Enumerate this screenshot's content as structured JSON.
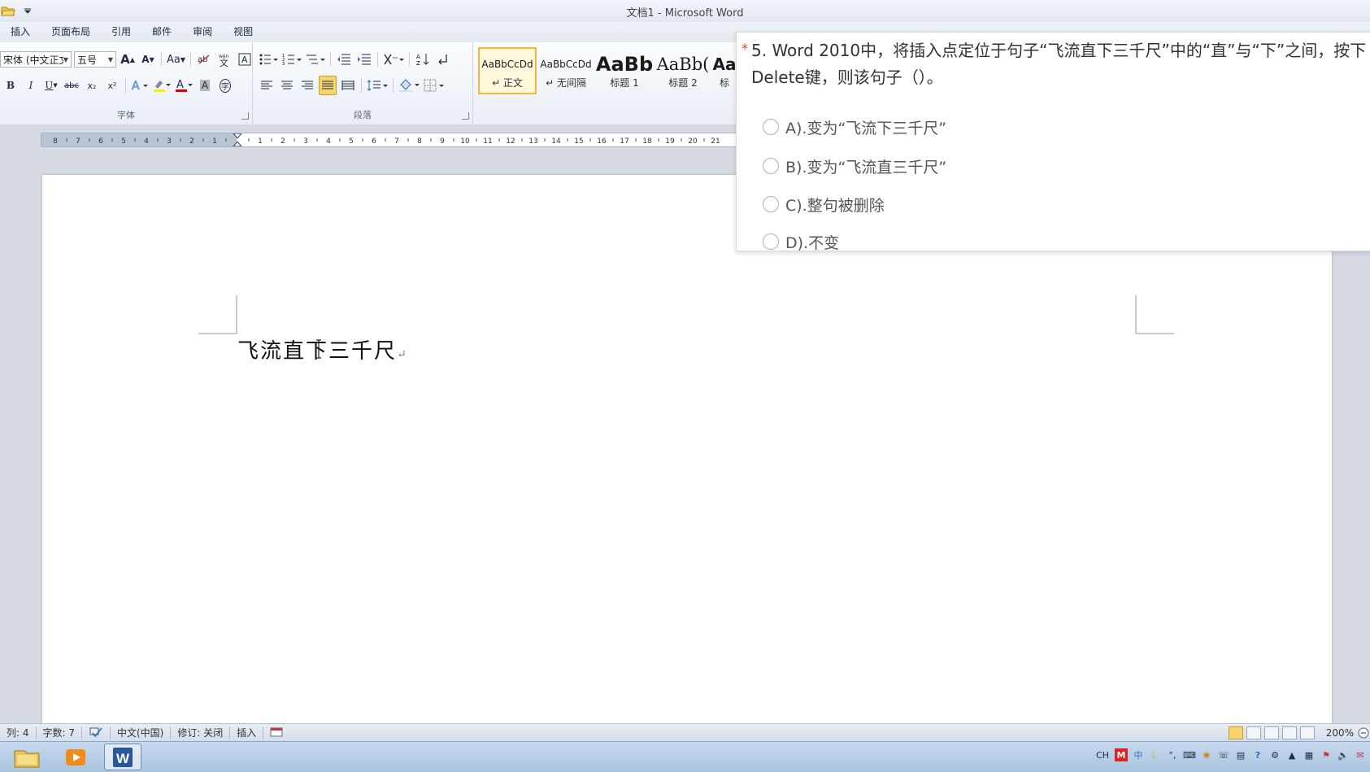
{
  "window": {
    "title": "文档1  -  Microsoft Word"
  },
  "tabs": [
    "插入",
    "页面布局",
    "引用",
    "邮件",
    "审阅",
    "视图"
  ],
  "ribbon": {
    "font": {
      "name": "宋体 (中文正文",
      "size": "五号",
      "group_label": "字体",
      "grow": "A",
      "shrink": "A",
      "change_case": "Aa",
      "bold": "B",
      "italic": "I",
      "underline": "U",
      "strike": "abc",
      "subscript": "x₂",
      "superscript": "x²",
      "color_a": "A",
      "char_shade": "A",
      "encircle": "字"
    },
    "paragraph": {
      "group_label": "段落"
    },
    "styles": [
      {
        "sample": "AaBbCcDd",
        "name": "↵ 正文",
        "selected": true
      },
      {
        "sample": "AaBbCcDd",
        "name": "↵ 无间隔",
        "selected": false
      },
      {
        "sample": "AaBb",
        "name": "标题 1",
        "selected": false
      },
      {
        "sample": "AaBb(",
        "name": "标题 2",
        "selected": false
      },
      {
        "sample": "Aa",
        "name": "标",
        "selected": false
      }
    ]
  },
  "ruler": {
    "left_numbers": [
      "8",
      "7",
      "6",
      "5",
      "4",
      "3",
      "2",
      "1"
    ],
    "right_numbers": [
      "1",
      "2",
      "3",
      "4",
      "5",
      "6",
      "7",
      "8",
      "9",
      "10",
      "11",
      "12",
      "13",
      "14",
      "15",
      "16",
      "17",
      "18",
      "19",
      "20",
      "21"
    ]
  },
  "document": {
    "text": "飞流直下三千尺",
    "para_mark": "↵"
  },
  "question": {
    "star": "*",
    "text": "5. Word 2010中，将插入点定位于句子“飞流直下三千尺”中的“直”与“下”之间，按下Delete键，则该句子（）。",
    "options": [
      {
        "label": "A).变为“飞流下三千尺”"
      },
      {
        "label": "B).变为“飞流直三千尺”"
      },
      {
        "label": "C).整句被删除"
      },
      {
        "label": "D).不变"
      }
    ]
  },
  "status": {
    "column": "列: 4",
    "wordcount": "字数: 7",
    "language": "中文(中国)",
    "track": "修订: 关闭",
    "mode": "插入",
    "zoom": "200%"
  },
  "taskbar": {
    "tray_lang": "CH",
    "tray_ime": "中"
  },
  "colors": {
    "accent_yellow": "#f7d56e",
    "question_star": "#e2442f",
    "word_blue": "#2b579a"
  }
}
